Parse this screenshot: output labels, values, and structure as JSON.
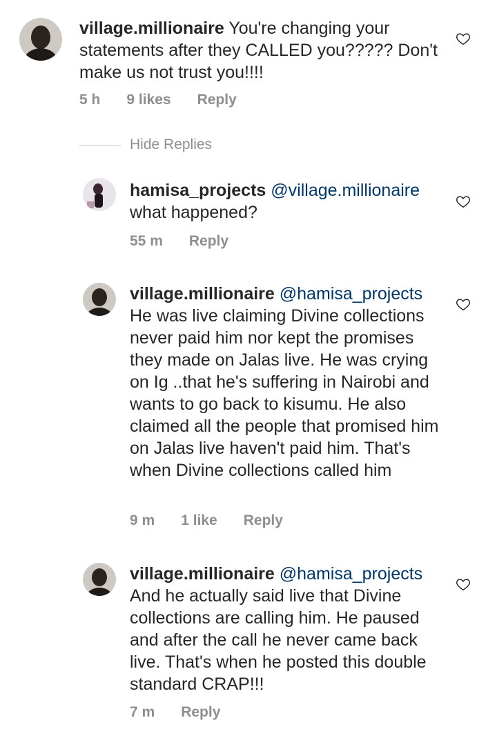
{
  "comments": [
    {
      "username": "village.millionaire",
      "mention": "",
      "text": "You're changing your statements after they CALLED you????? Don't make us not trust you!!!!",
      "time": "5 h",
      "likes": "9 likes",
      "reply_label": "Reply"
    },
    {
      "username": "hamisa_projects",
      "mention": "@village.millionaire",
      "text": "what happened?",
      "time": "55 m",
      "likes": "",
      "reply_label": "Reply"
    },
    {
      "username": "village.millionaire",
      "mention": "@hamisa_projects",
      "text": "He was live claiming Divine collections never paid him nor kept the promises they made on Jalas live. He was crying on Ig ..that he's suffering in Nairobi and wants to go back to kisumu. He also claimed all the people that promised him on Jalas live haven't paid him. That's when Divine collections called him",
      "time": "9 m",
      "likes": "1 like",
      "reply_label": "Reply"
    },
    {
      "username": "village.millionaire",
      "mention": "@hamisa_projects",
      "text": "And he actually said live that Divine collections are calling him. He paused and after the call he never came back live. That's when he posted this double standard CRAP!!!",
      "time": "7 m",
      "likes": "",
      "reply_label": "Reply"
    }
  ],
  "thread": {
    "hide_replies_label": "Hide Replies"
  },
  "icons": {
    "like": "heart-outline-icon",
    "avatar": "avatar"
  },
  "colors": {
    "text": "#262626",
    "meta": "#8e8e8e",
    "mention": "#00376b",
    "background": "#ffffff"
  }
}
